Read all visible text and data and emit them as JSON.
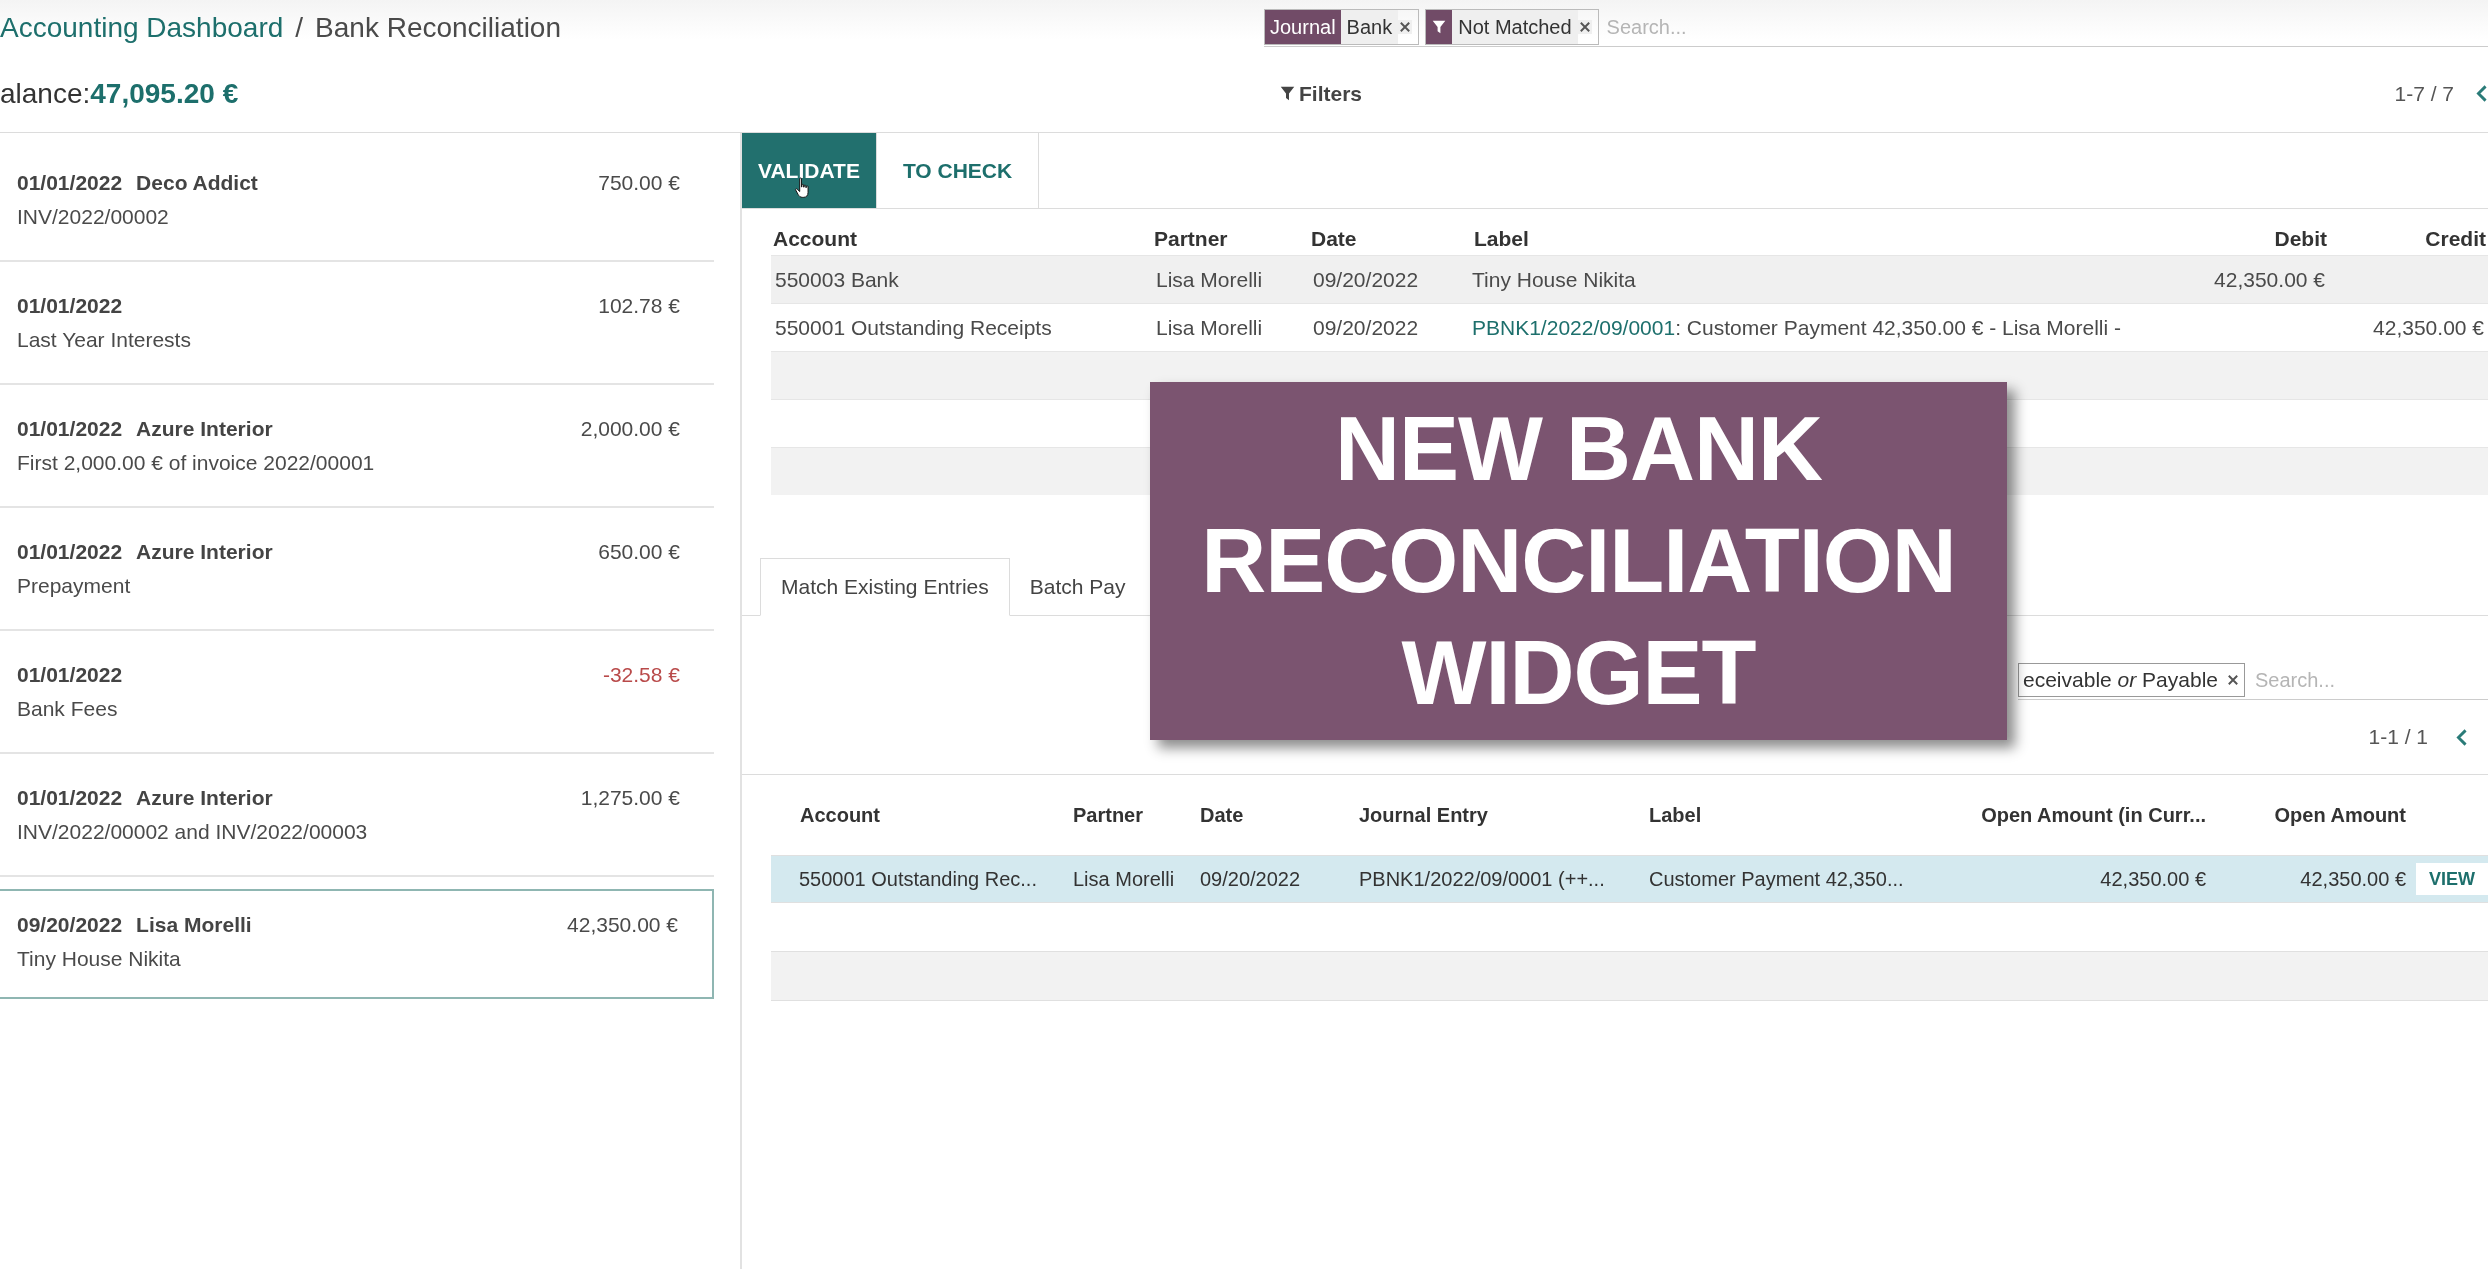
{
  "breadcrumb": {
    "parent": "Accounting Dashboard",
    "separator": "/",
    "current": "Bank Reconciliation"
  },
  "search": {
    "facets": [
      {
        "kind": "field",
        "field": "Journal",
        "value": "Bank"
      },
      {
        "kind": "filter",
        "value": "Not Matched"
      }
    ],
    "placeholder": "Search..."
  },
  "balance": {
    "label": "alance:",
    "amount": "47,095.20 €"
  },
  "filters_button": "Filters",
  "pager": "1-7 / 7",
  "statements": [
    {
      "date": "01/01/2022",
      "partner": "Deco Addict",
      "reference": "INV/2022/00002",
      "amount": "750.00 €",
      "negative": false,
      "selected": false
    },
    {
      "date": "01/01/2022",
      "reference": "Last Year Interests",
      "amount": "102.78 €",
      "negative": false,
      "selected": false
    },
    {
      "date": "01/01/2022",
      "partner": "Azure Interior",
      "reference": "First 2,000.00 € of invoice 2022/00001",
      "amount": "2,000.00 €",
      "negative": false,
      "selected": false
    },
    {
      "date": "01/01/2022",
      "partner": "Azure Interior",
      "reference": "Prepayment",
      "amount": "650.00 €",
      "negative": false,
      "selected": false
    },
    {
      "date": "01/01/2022",
      "reference": "Bank Fees",
      "amount": "-32.58 €",
      "negative": true,
      "selected": false
    },
    {
      "date": "01/01/2022",
      "partner": "Azure Interior",
      "reference": "INV/2022/00002 and INV/2022/00003",
      "amount": "1,275.00 €",
      "negative": false,
      "selected": false
    },
    {
      "date": "09/20/2022",
      "partner": "Lisa Morelli",
      "reference": "Tiny House Nikita",
      "amount": "42,350.00 €",
      "negative": false,
      "selected": true
    }
  ],
  "actions": [
    {
      "label": "VALIDATE",
      "primary": true
    },
    {
      "label": "TO CHECK",
      "primary": false
    }
  ],
  "lines_table": {
    "columns": [
      "Account",
      "Partner",
      "Date",
      "Label",
      "Debit",
      "Credit"
    ],
    "rows": [
      {
        "account": "550003 Bank",
        "partner": "Lisa Morelli",
        "date": "09/20/2022",
        "label": "Tiny House Nikita",
        "debit": "42,350.00 €"
      },
      {
        "account": "550001 Outstanding Receipts",
        "partner": "Lisa Morelli",
        "date": "09/20/2022",
        "label_link": "PBNK1/2022/09/0001",
        "label": ": Customer Payment 42,350.00 € - Lisa Morelli -",
        "credit": "42,350.00 €"
      }
    ]
  },
  "match_tabs": [
    {
      "label": "Match Existing Entries",
      "selected": true
    },
    {
      "label": "Batch Pay",
      "selected": false
    }
  ],
  "match_search": {
    "facet": "eceivable *or* Payable",
    "placeholder": "Search..."
  },
  "match_pager": "1-1 / 1",
  "match_table": {
    "columns": [
      "Account",
      "Partner",
      "Date",
      "Journal Entry",
      "Label",
      "Open Amount (in Curr...",
      "Open Amount"
    ],
    "rows": [
      {
        "account": "550001 Outstanding Rec...",
        "partner": "Lisa Morelli",
        "date": "09/20/2022",
        "journal_entry": "PBNK1/2022/09/0001 (++...",
        "label": "Customer Payment 42,350...",
        "amount_currency": "42,350.00 €",
        "amount": "42,350.00 €",
        "action": "VIEW",
        "selected": true
      }
    ]
  },
  "overlay": {
    "lines": [
      "NEW BANK",
      "RECONCILIATION",
      "WIDGET"
    ]
  }
}
